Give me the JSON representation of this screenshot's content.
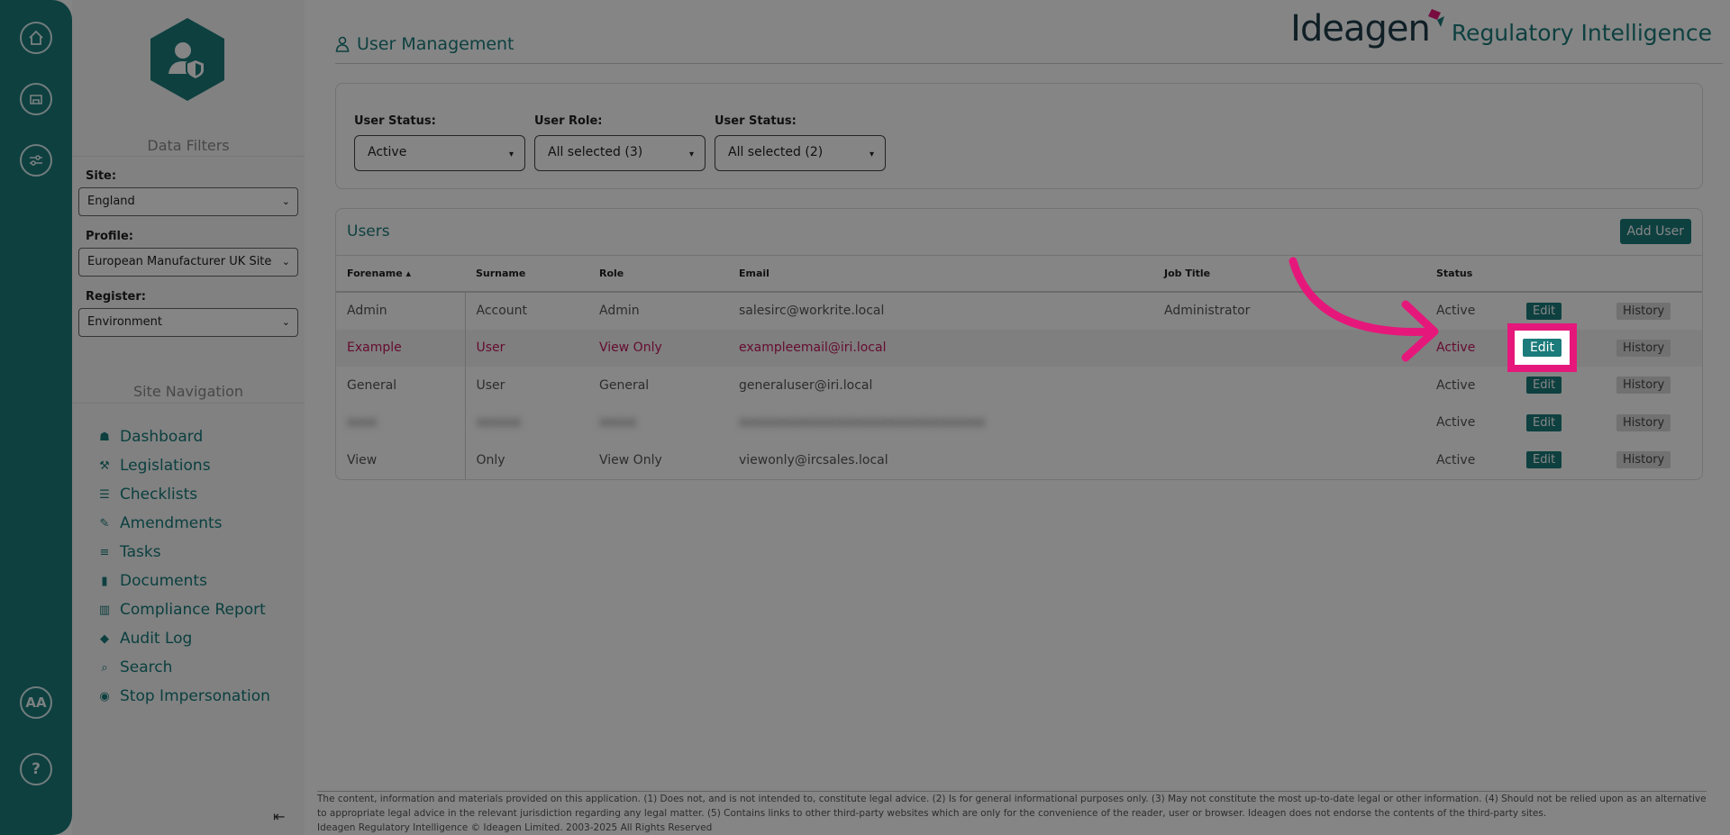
{
  "sidebar": {
    "data_filters_title": "Data Filters",
    "filters": {
      "site_label": "Site:",
      "site_value": "England",
      "profile_label": "Profile:",
      "profile_value": "European Manufacturer UK Site",
      "register_label": "Register:",
      "register_value": "Environment"
    },
    "site_navigation_title": "Site Navigation",
    "nav": [
      {
        "label": "Dashboard",
        "icon": "dashboard-icon",
        "glyph": "☗"
      },
      {
        "label": "Legislations",
        "icon": "gavel-icon",
        "glyph": "⚒"
      },
      {
        "label": "Checklists",
        "icon": "list-icon",
        "glyph": "☰"
      },
      {
        "label": "Amendments",
        "icon": "edit-icon",
        "glyph": "✎"
      },
      {
        "label": "Tasks",
        "icon": "tasks-icon",
        "glyph": "≡"
      },
      {
        "label": "Documents",
        "icon": "document-icon",
        "glyph": "▮"
      },
      {
        "label": "Compliance Report",
        "icon": "bar-chart-icon",
        "glyph": "▥"
      },
      {
        "label": "Audit Log",
        "icon": "tags-icon",
        "glyph": "◆"
      },
      {
        "label": "Search",
        "icon": "search-icon",
        "glyph": "⌕"
      },
      {
        "label": "Stop Impersonation",
        "icon": "stop-icon",
        "glyph": "◉"
      }
    ]
  },
  "rail": {
    "aa_label": "AA",
    "help_label": "?"
  },
  "header": {
    "page_title": "User Management",
    "brand_name": "Ideagen",
    "brand_sub": "Regulatory Intelligence"
  },
  "filters_bar": {
    "status_label": "User Status:",
    "status_value": "Active",
    "role_label": "User Role:",
    "role_value": "All selected (3)",
    "status2_label": "User Status:",
    "status2_value": "All selected (2)"
  },
  "users": {
    "title": "Users",
    "add_button": "Add User",
    "columns": [
      "Forename ▴",
      "Surname",
      "Role",
      "Email",
      "Job Title",
      "Status",
      "",
      ""
    ],
    "edit_label": "Edit",
    "history_label": "History",
    "rows": [
      {
        "forename": "Admin",
        "surname": "Account",
        "role": "Admin",
        "email": "salesirc@workrite.local",
        "job_title": "Administrator",
        "status": "Active"
      },
      {
        "forename": "Example",
        "surname": "User",
        "role": "View Only",
        "email": "exampleemail@iri.local",
        "job_title": "",
        "status": "Active"
      },
      {
        "forename": "General",
        "surname": "User",
        "role": "General",
        "email": "generaluser@iri.local",
        "job_title": "",
        "status": "Active"
      },
      {
        "forename": "xxxx",
        "surname": "xxxxxx",
        "role": "xxxxx",
        "email": "xxxxxxxxxxxxxxxxxxxxxxxxxxxxxxxxx",
        "job_title": "",
        "status": "Active"
      },
      {
        "forename": "View",
        "surname": "Only",
        "role": "View Only",
        "email": "viewonly@ircsales.local",
        "job_title": "",
        "status": "Active"
      }
    ]
  },
  "footer": {
    "text": "The content, information and materials provided on this application. (1) Does not, and is not intended to, constitute legal advice. (2) Is for general informational purposes only. (3) May not constitute the most up-to-date legal or other information. (4) Should not be relied upon as an alternative to appropriate legal advice in the relevant jurisdiction regarding any legal matter. (5) Contains links to other third-party websites which are only for the convenience of the reader, user or browser. Ideagen does not endorse the contents of the third-party sites.",
    "copyright": "Ideagen Regulatory Intelligence © Ideagen Limited. 2003-2025 All Rights Reserved"
  },
  "colors": {
    "teal": "#1c7b7b",
    "highlight_pink": "#e6177b",
    "row_highlight_text": "#c2185b"
  }
}
